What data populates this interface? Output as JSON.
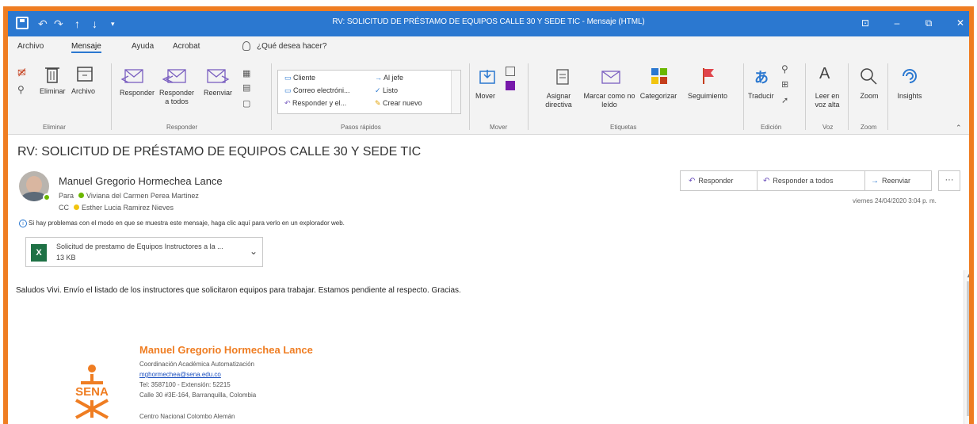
{
  "window": {
    "title": "RV: SOLICITUD DE PRÉSTAMO DE EQUIPOS CALLE 30 Y SEDE TIC - Mensaje (HTML)",
    "controls": {
      "help": "⊡",
      "minimize": "–",
      "restore": "⧉",
      "close": "✕"
    }
  },
  "menu": {
    "tabs": [
      "Archivo",
      "Mensaje",
      "Ayuda",
      "Acrobat"
    ],
    "active_tab": "Mensaje",
    "tell_me": "¿Qué desea hacer?"
  },
  "ribbon": {
    "delete_group": {
      "delete": "Eliminar",
      "archive": "Archivo",
      "label": "Eliminar"
    },
    "respond_group": {
      "reply": "Responder",
      "reply_all": "Responder a todos",
      "forward": "Reenviar",
      "label": "Responder"
    },
    "quick_steps": {
      "items": [
        "Cliente",
        "Correo electróni...",
        "Responder y el...",
        "Al jefe",
        "Listo",
        "Crear nuevo"
      ],
      "label": "Pasos rápidos"
    },
    "move_group": {
      "move": "Mover",
      "label": "Mover"
    },
    "tags_group": {
      "assign_policy": "Asignar directiva",
      "mark_unread": "Marcar como no leído",
      "categorize": "Categorizar",
      "follow_up": "Seguimiento",
      "label": "Etiquetas"
    },
    "editing_group": {
      "translate": "Traducir",
      "label": "Edición"
    },
    "voice_group": {
      "read_aloud": "Leer en voz alta",
      "label": "Voz"
    },
    "zoom_group": {
      "zoom": "Zoom",
      "label": "Zoom"
    },
    "insights": "Insights"
  },
  "message": {
    "subject": "RV: SOLICITUD DE PRÉSTAMO DE EQUIPOS CALLE 30 Y SEDE TIC",
    "sender": "Manuel Gregorio Hormechea Lance",
    "to_label": "Para",
    "to": "Viviana del Carmen Perea Martinez",
    "cc_label": "CC",
    "cc": "Esther Lucia Ramirez Nieves",
    "info_bar": "Si hay problemas con el modo en que se muestra este mensaje, haga clic aquí para verlo en un explorador web.",
    "date": "viernes 24/04/2020 3:04 p. m.",
    "actions": {
      "reply": "Responder",
      "reply_all": "Responder a todos",
      "forward": "Reenviar",
      "more": "···"
    },
    "attachment": {
      "name": "Solicitud de prestamo de Equipos Instructores a la ...",
      "size": "13 KB"
    },
    "body": "Saludos Vivi. Envío el listado de los instructores que solicitaron equipos para trabajar. Estamos pendiente al respecto. Gracias."
  },
  "signature": {
    "name": "Manuel Gregorio Hormechea Lance",
    "role": "Coordinación Académica Automatización",
    "email": "mghormechea@sena.edu.co",
    "phone": "Tel: 3587100 - Extensión: 52215",
    "address": "Calle 30 #3E-164, Barranquilla, Colombia",
    "center": "Centro Nacional Colombo Alemán",
    "logo_text": "SENA"
  },
  "colors": {
    "titlebar": "#2b78d0",
    "accent_frame": "#ef7d22",
    "signature_name": "#ef7d22",
    "sena_green": "#39a900"
  }
}
